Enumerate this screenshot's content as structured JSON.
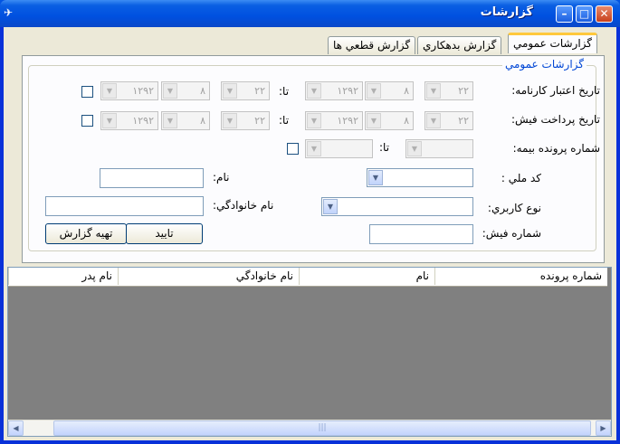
{
  "window": {
    "title": "گزارشات",
    "icon": "app-icon"
  },
  "tabs": [
    {
      "label": "گزارشات عمومي",
      "active": true
    },
    {
      "label": "گزارش بدهكاري",
      "active": false
    },
    {
      "label": "گزارش قطعي ها",
      "active": false
    }
  ],
  "group": {
    "title": "گزارشات عمومي"
  },
  "labels": {
    "workbook_date": "تاريخ اعتبار كارنامه:",
    "receipt_date": "تاريخ پرداخت فيش:",
    "insurance_file": "شماره پرونده بيمه:",
    "to": "تا:",
    "national_code": "كد ملي :",
    "first_name": "نام:",
    "user_type": "نوع كاربري:",
    "last_name": "نام خانوادگي:",
    "receipt_number": "شماره فيش:"
  },
  "dates": {
    "day": "۲۲",
    "month": "۸",
    "year": "۱۲۹۲"
  },
  "buttons": {
    "confirm": "تاييد",
    "prepare_report": "تهيه گزارش"
  },
  "grid": {
    "columns": [
      "شماره پرونده",
      "نام",
      "نام خانوادگي",
      "نام پدر"
    ]
  },
  "icons": {
    "minimize": "minimize-icon",
    "maximize": "maximize-icon",
    "close": "close-icon",
    "dropdown": "chevron-down-icon"
  },
  "colors": {
    "title_bar": "#0a5fe3",
    "tab_highlight": "#ffc83c",
    "group_title": "#0046d5",
    "grid_body": "#808080"
  }
}
